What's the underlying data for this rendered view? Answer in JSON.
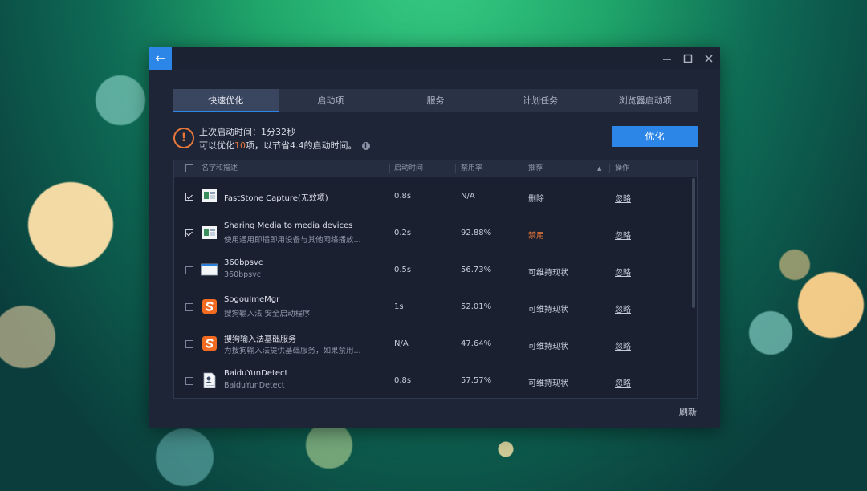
{
  "window": {
    "back_glyph": "←",
    "controls": [
      "minimize-icon",
      "maximize-icon",
      "close-icon"
    ]
  },
  "tabs": [
    {
      "label": "快速优化",
      "active": true
    },
    {
      "label": "启动项",
      "active": false
    },
    {
      "label": "服务",
      "active": false
    },
    {
      "label": "计划任务",
      "active": false
    },
    {
      "label": "浏览器启动项",
      "active": false
    }
  ],
  "info": {
    "alert_glyph": "!",
    "line1": "上次启动时间：1分32秒",
    "line2_prefix": "可以优化",
    "line2_count": "10",
    "line2_suffix": "项，以节省4.4的启动时间。",
    "info_glyph": "i"
  },
  "optimize_button": "优化",
  "table": {
    "headers": {
      "name": "名字和描述",
      "boot_time": "启动时间",
      "disable_rate": "禁用率",
      "recommend": "推荐",
      "sort_glyph": "▲",
      "action": "操作"
    },
    "rows": [
      {
        "checked": true,
        "icon": "faststone-app-icon",
        "name": "FastStone Capture(无效项)",
        "desc": "",
        "time": "0.8s",
        "rate": "N/A",
        "recommend": "删除",
        "recommend_color": "",
        "action": "忽略"
      },
      {
        "checked": true,
        "icon": "sharing-media-app-icon",
        "name": "Sharing Media to media devices",
        "desc": "使用通用即插即用设备与其他网络播放...",
        "time": "0.2s",
        "rate": "92.88%",
        "recommend": "禁用",
        "recommend_color": "#e8773a",
        "action": "忽略"
      },
      {
        "checked": false,
        "icon": "360-window-app-icon",
        "name": "360bpsvc",
        "desc": "360bpsvc",
        "time": "0.5s",
        "rate": "56.73%",
        "recommend": "可维持现状",
        "recommend_color": "",
        "action": "忽略"
      },
      {
        "checked": false,
        "icon": "sogou-app-icon",
        "name": "SogouImeMgr",
        "desc": "搜狗输入法 安全启动程序",
        "time": "1s",
        "rate": "52.01%",
        "recommend": "可维持现状",
        "recommend_color": "",
        "action": "忽略"
      },
      {
        "checked": false,
        "icon": "sogou-app-icon",
        "name": "搜狗输入法基础服务",
        "desc": "为搜狗输入法提供基础服务，如果禁用...",
        "time": "N/A",
        "rate": "47.64%",
        "recommend": "可维持现状",
        "recommend_color": "",
        "action": "忽略"
      },
      {
        "checked": false,
        "icon": "document-user-app-icon",
        "name": "BaiduYunDetect",
        "desc": "BaiduYunDetect",
        "time": "0.8s",
        "rate": "57.57%",
        "recommend": "可维持现状",
        "recommend_color": "",
        "action": "忽略"
      }
    ]
  },
  "refresh_link": "刷新",
  "colors": {
    "accent": "#2b86e8",
    "warning": "#e8773a",
    "window_bg": "#1e2536"
  }
}
